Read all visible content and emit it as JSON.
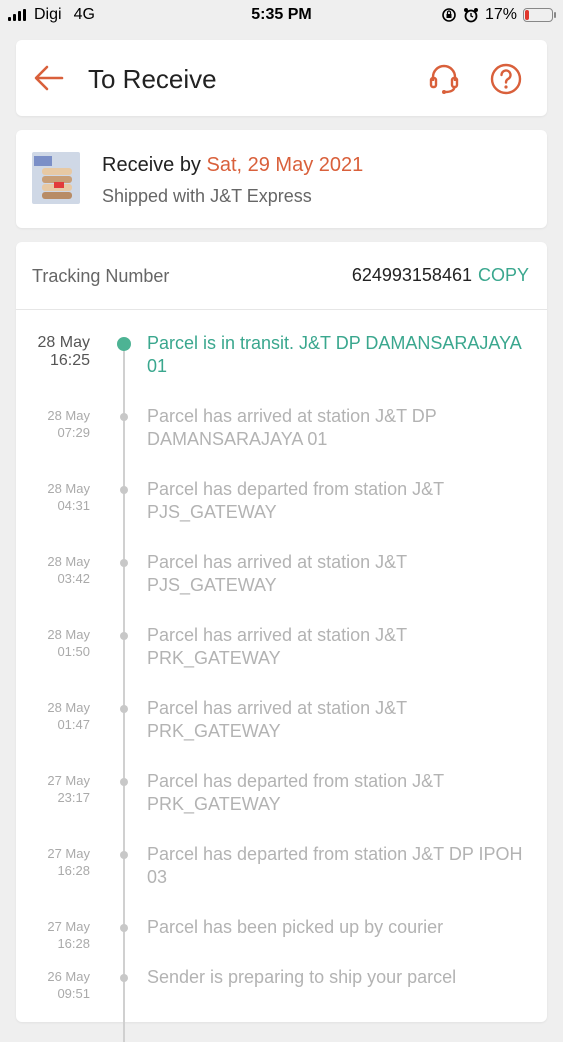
{
  "status_bar": {
    "carrier": "Digi",
    "network": "4G",
    "time": "5:35 PM",
    "battery": "17%",
    "battery_level": 0.17,
    "battery_color": "#e0362c"
  },
  "header": {
    "title": "To Receive",
    "back_icon": "arrow-left-icon",
    "chat_icon": "headset-icon",
    "help_icon": "question-circle-icon",
    "accent": "#d9603b"
  },
  "delivery": {
    "receive_prefix": "Receive by",
    "receive_date": "Sat, 29 May 2021",
    "shipped_with": "Shipped with J&T Express"
  },
  "tracking": {
    "label": "Tracking Number",
    "number": "624993158461",
    "copy_label": "COPY",
    "copy_color": "#3aa78e"
  },
  "events": [
    {
      "date": "28 May",
      "time": "16:25",
      "text": "Parcel is in transit. J&T DP DAMANSARAJAYA 01",
      "active": true
    },
    {
      "date": "28 May",
      "time": "07:29",
      "text": "Parcel has arrived at station J&T DP DAMANSARAJAYA 01"
    },
    {
      "date": "28 May",
      "time": "04:31",
      "text": "Parcel has departed from station J&T PJS_GATEWAY"
    },
    {
      "date": "28 May",
      "time": "03:42",
      "text": "Parcel has arrived at station J&T PJS_GATEWAY"
    },
    {
      "date": "28 May",
      "time": "01:50",
      "text": "Parcel has arrived at station J&T PRK_GATEWAY"
    },
    {
      "date": "28 May",
      "time": "01:47",
      "text": "Parcel has arrived at station J&T PRK_GATEWAY"
    },
    {
      "date": "27 May",
      "time": "23:17",
      "text": "Parcel has departed from station J&T PRK_GATEWAY"
    },
    {
      "date": "27 May",
      "time": "16:28",
      "text": "Parcel has departed from station J&T DP IPOH 03"
    },
    {
      "date": "27 May",
      "time": "16:28",
      "text": "Parcel has been picked up by courier"
    },
    {
      "date": "26 May",
      "time": "09:51",
      "text": "Sender is preparing to ship your parcel"
    }
  ]
}
